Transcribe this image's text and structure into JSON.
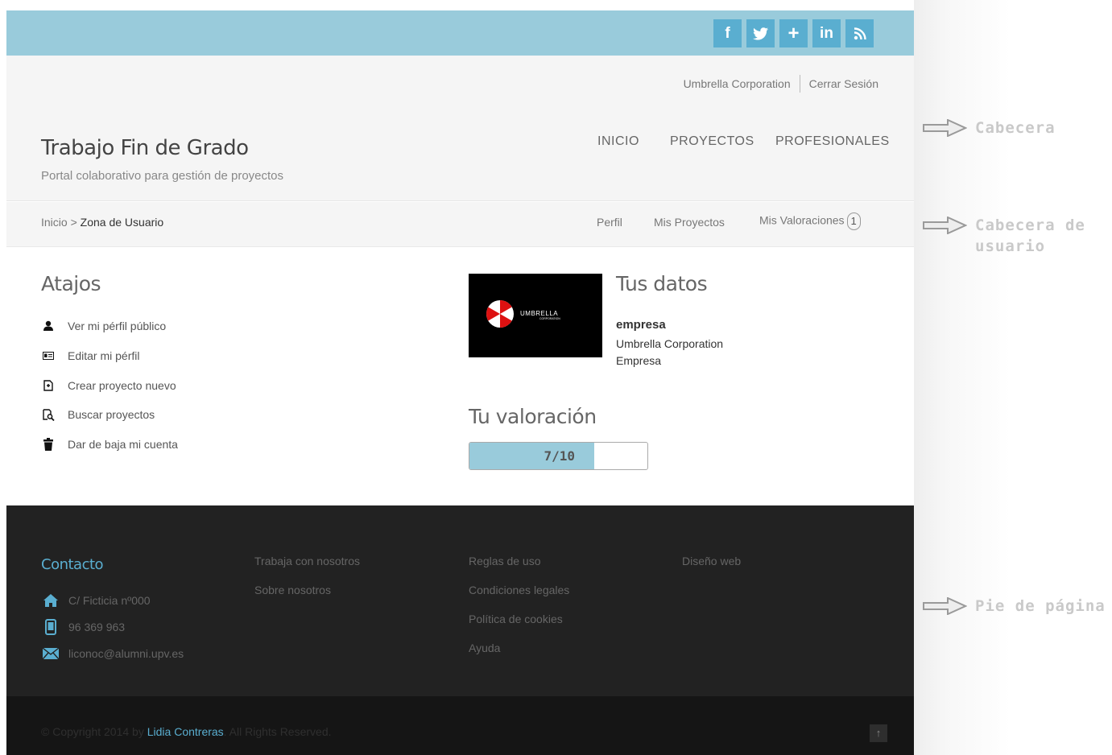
{
  "social": {
    "facebook": "f",
    "twitter": "twitter-icon",
    "googleplus": "+",
    "linkedin": "in",
    "rss": "rss-icon"
  },
  "header": {
    "company_link": "Umbrella Corporation",
    "logout_link": "Cerrar Sesión",
    "title": "Trabajo Fin de Grado",
    "subtitle": "Portal colaborativo para gestión de proyectos",
    "nav": [
      "INICIO",
      "PROYECTOS",
      "PROFESIONALES"
    ]
  },
  "userbar": {
    "breadcrumb_home": "Inicio",
    "breadcrumb_sep": ">",
    "breadcrumb_current": "Zona de Usuario",
    "nav": [
      "Perfil",
      "Mis Proyectos",
      "Mis Valoraciones"
    ],
    "ratings_count": "1"
  },
  "shortcuts": {
    "title": "Atajos",
    "items": [
      {
        "label": "Ver mi pérfil público",
        "icon": "user-icon"
      },
      {
        "label": "Editar mi pérfil",
        "icon": "id-card-icon"
      },
      {
        "label": "Crear proyecto nuevo",
        "icon": "new-file-icon"
      },
      {
        "label": "Buscar proyectos",
        "icon": "search-document-icon"
      },
      {
        "label": "Dar de baja mi cuenta",
        "icon": "trash-icon"
      }
    ]
  },
  "profile": {
    "title": "Tus datos",
    "logo_text": "UMBRELLA",
    "logo_subtext": "CORPORATION",
    "username": "empresa",
    "company": "Umbrella Corporation",
    "type": "Empresa"
  },
  "rating": {
    "title": "Tu valoración",
    "label": "7/10",
    "value": 7,
    "max": 10,
    "fill_color": "#99cbdb"
  },
  "footer": {
    "contact_title": "Contacto",
    "address": "C/ Ficticia nº000",
    "phone": "96 369 963",
    "email": "liconoc@alumni.upv.es",
    "col2": [
      "Trabaja con nosotros",
      "Sobre nosotros"
    ],
    "col3": [
      "Reglas de uso",
      "Condiciones legales",
      "Política de cookies",
      "Ayuda"
    ],
    "col4": [
      "Diseño web"
    ],
    "copyright_pre": "© Copyright 2014 by",
    "copyright_author": "Lidia Contreras",
    "copyright_post": ". All Rights Reserved.",
    "to_top": "↑"
  },
  "annotations": [
    "Cabecera",
    "Cabecera de usuario",
    "Pie de página"
  ],
  "colors": {
    "accent": "#99cbdb",
    "social_bg": "#5aaed0",
    "footer_bg": "#222222",
    "bottom_bg": "#151515"
  }
}
